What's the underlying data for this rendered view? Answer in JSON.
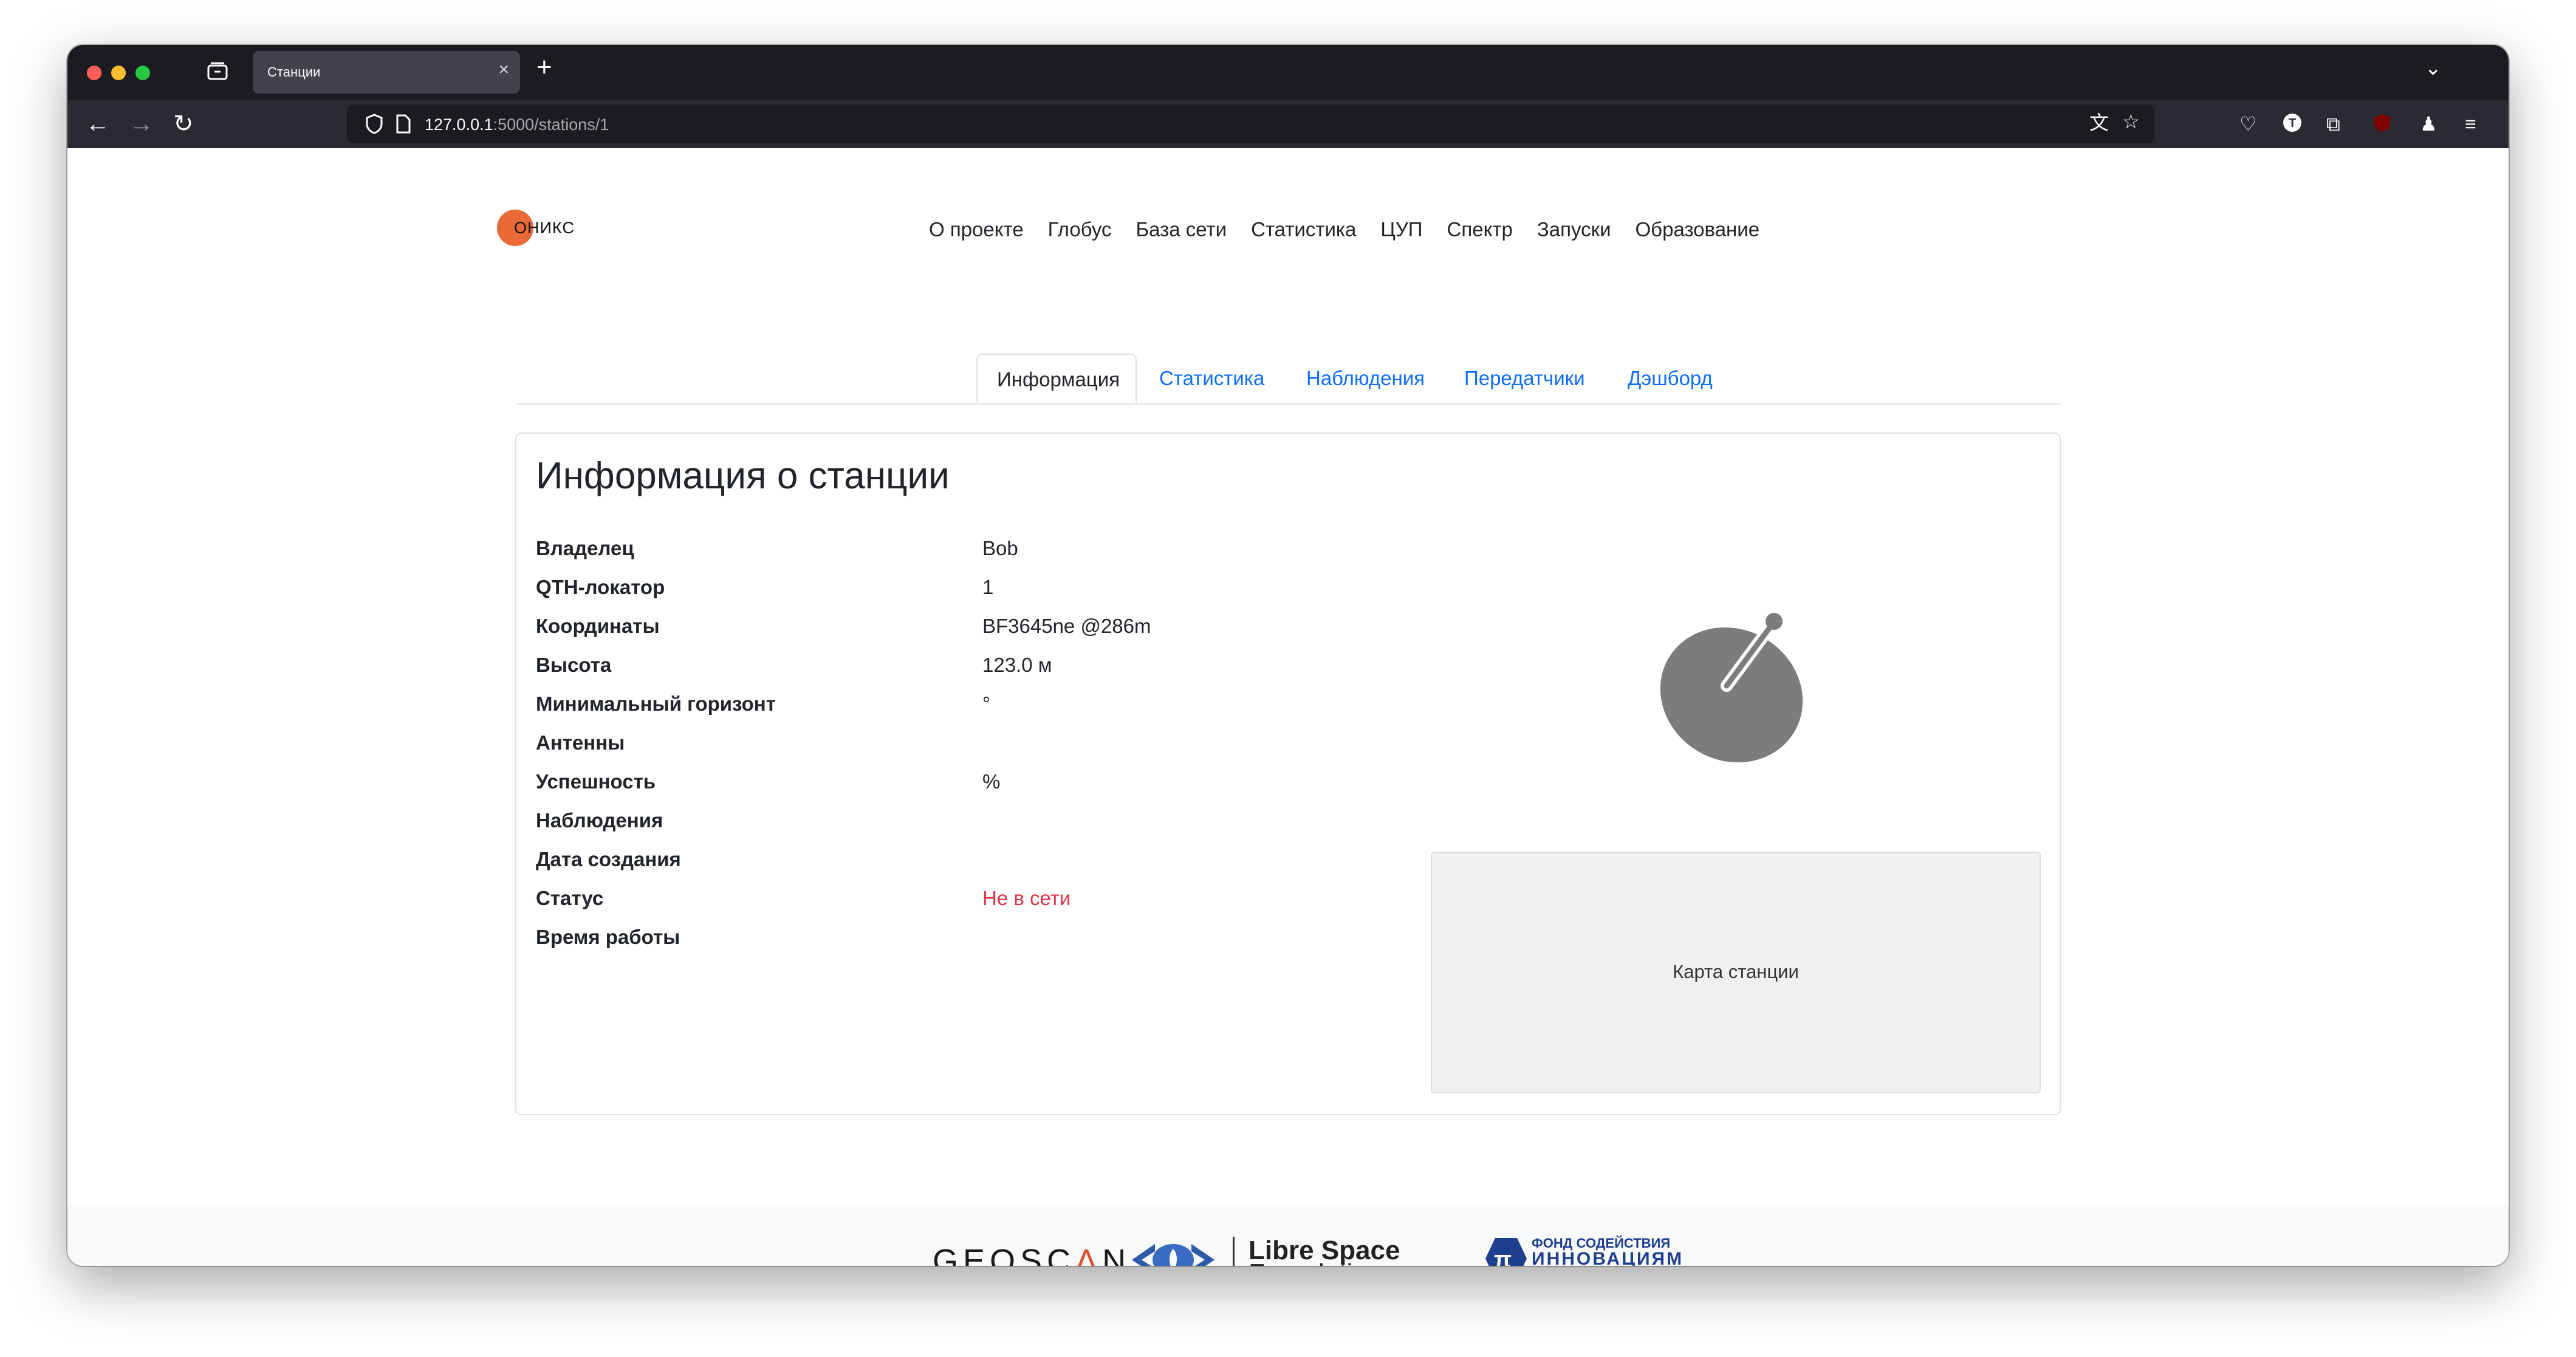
{
  "browser": {
    "tab_title": "Станции",
    "url_host": "127.0.0.1",
    "url_path": ":5000/stations/1"
  },
  "site": {
    "logo_text": "ОНИКС",
    "nav": [
      "О проекте",
      "Глобус",
      "База сети",
      "Статистика",
      "ЦУП",
      "Спектр",
      "Запуски",
      "Образование"
    ]
  },
  "tabs": [
    "Информация",
    "Статистика",
    "Наблюдения",
    "Передатчики",
    "Дэшборд"
  ],
  "active_tab": "Информация",
  "card": {
    "title": "Информация о станции",
    "rows": [
      {
        "label": "Владелец",
        "value": "Bob"
      },
      {
        "label": "QTH-локатор",
        "value": "1"
      },
      {
        "label": "Координаты",
        "value": "BF3645ne @286m"
      },
      {
        "label": "Высота",
        "value": "123.0 м"
      },
      {
        "label": "Минимальный горизонт",
        "value": "°"
      },
      {
        "label": "Антенны",
        "value": ""
      },
      {
        "label": "Успешность",
        "value": "%"
      },
      {
        "label": "Наблюдения",
        "value": ""
      },
      {
        "label": "Дата создания",
        "value": ""
      },
      {
        "label": "Статус",
        "value": "Не в сети"
      },
      {
        "label": "Время работы",
        "value": ""
      }
    ],
    "map_label": "Карта станции"
  },
  "footer": {
    "geoscan": "GEOSCAN",
    "lsf_line1": "Libre Space",
    "lsf_line2": "Foundation",
    "fsi_line1": "ФОНД СОДЕЙСТВИЯ",
    "fsi_line2": "ИННОВАЦИЯМ"
  },
  "colors": {
    "link": "#0d6efd",
    "status_offline": "#dc3545",
    "logo_accent": "#e96a36"
  }
}
